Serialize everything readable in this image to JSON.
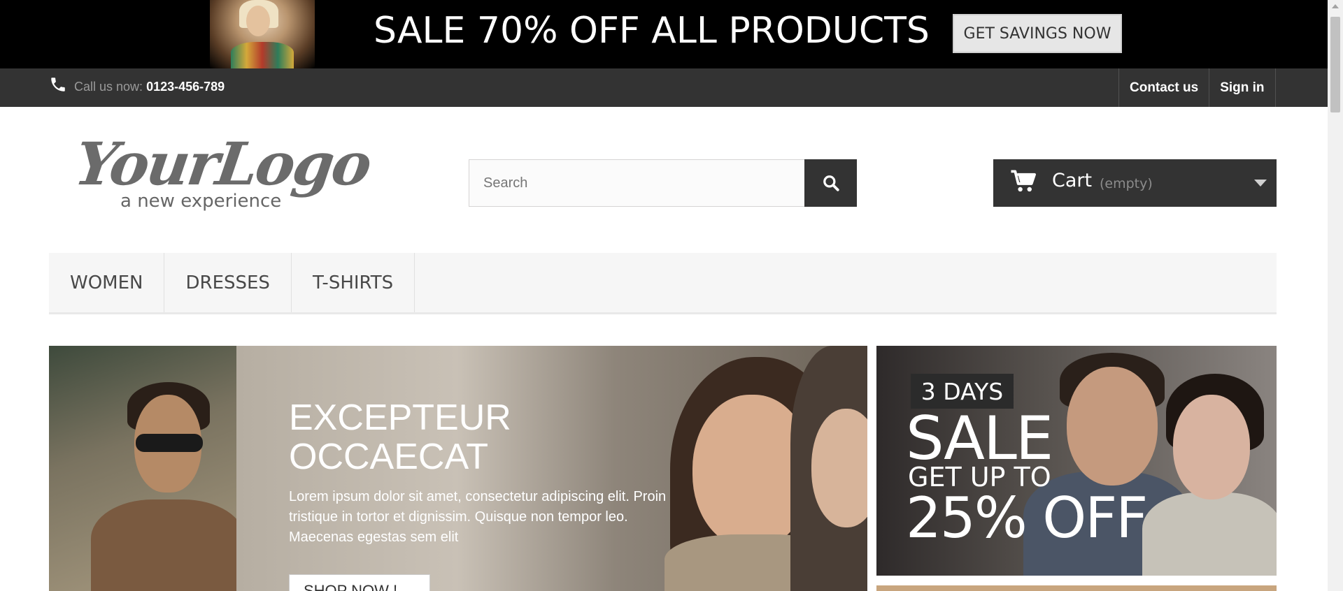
{
  "promo": {
    "headline": "SALE 70% OFF ALL PRODUCTS",
    "button_label": "GET SAVINGS NOW"
  },
  "topbar": {
    "call_label": "Call us now:",
    "phone": "0123-456-789",
    "links": [
      "Contact us",
      "Sign in"
    ]
  },
  "logo": {
    "name": "YourLogo",
    "tagline": "a new experience"
  },
  "search": {
    "placeholder": "Search"
  },
  "cart": {
    "label": "Cart",
    "status": "(empty)"
  },
  "menu": {
    "items": [
      "WOMEN",
      "DRESSES",
      "T-SHIRTS"
    ]
  },
  "hero": {
    "title_line1": "EXCEPTEUR",
    "title_line2": "OCCAECAT",
    "text": "Lorem ipsum dolor sit amet, consectetur adipiscing elit. Proin tristique in tortor et dignissim. Quisque non tempor leo. Maecenas egestas sem elit",
    "button_label": "SHOP NOW !"
  },
  "side_banner": {
    "days": "3 DAYS",
    "sale": "SALE",
    "get_up_to": "GET UP TO",
    "discount": "25% OFF"
  },
  "colors": {
    "dark": "#333333",
    "promo_bg": "#000000",
    "menu_bg": "#f6f6f6"
  }
}
